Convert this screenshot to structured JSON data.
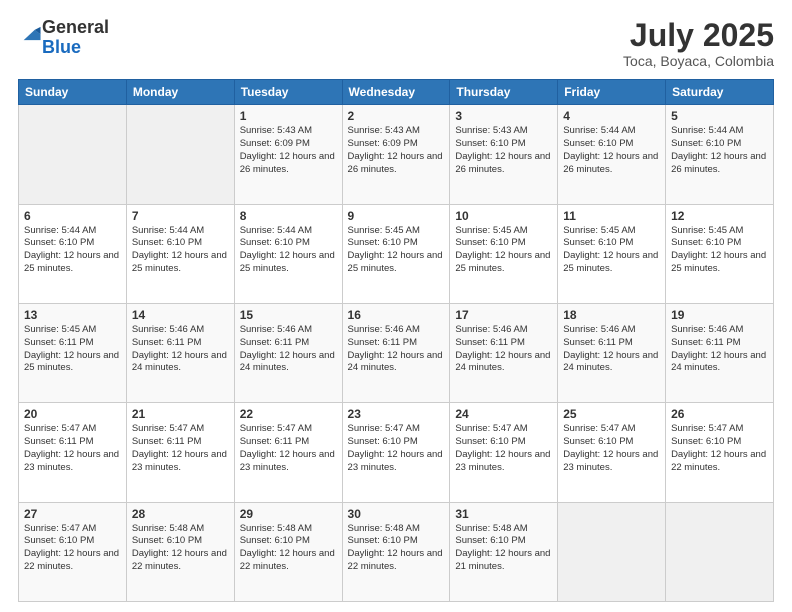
{
  "logo": {
    "general": "General",
    "blue": "Blue"
  },
  "title": {
    "month_year": "July 2025",
    "location": "Toca, Boyaca, Colombia"
  },
  "weekdays": [
    "Sunday",
    "Monday",
    "Tuesday",
    "Wednesday",
    "Thursday",
    "Friday",
    "Saturday"
  ],
  "weeks": [
    [
      {
        "day": "",
        "info": ""
      },
      {
        "day": "",
        "info": ""
      },
      {
        "day": "1",
        "info": "Sunrise: 5:43 AM\nSunset: 6:09 PM\nDaylight: 12 hours and 26 minutes."
      },
      {
        "day": "2",
        "info": "Sunrise: 5:43 AM\nSunset: 6:09 PM\nDaylight: 12 hours and 26 minutes."
      },
      {
        "day": "3",
        "info": "Sunrise: 5:43 AM\nSunset: 6:10 PM\nDaylight: 12 hours and 26 minutes."
      },
      {
        "day": "4",
        "info": "Sunrise: 5:44 AM\nSunset: 6:10 PM\nDaylight: 12 hours and 26 minutes."
      },
      {
        "day": "5",
        "info": "Sunrise: 5:44 AM\nSunset: 6:10 PM\nDaylight: 12 hours and 26 minutes."
      }
    ],
    [
      {
        "day": "6",
        "info": "Sunrise: 5:44 AM\nSunset: 6:10 PM\nDaylight: 12 hours and 25 minutes."
      },
      {
        "day": "7",
        "info": "Sunrise: 5:44 AM\nSunset: 6:10 PM\nDaylight: 12 hours and 25 minutes."
      },
      {
        "day": "8",
        "info": "Sunrise: 5:44 AM\nSunset: 6:10 PM\nDaylight: 12 hours and 25 minutes."
      },
      {
        "day": "9",
        "info": "Sunrise: 5:45 AM\nSunset: 6:10 PM\nDaylight: 12 hours and 25 minutes."
      },
      {
        "day": "10",
        "info": "Sunrise: 5:45 AM\nSunset: 6:10 PM\nDaylight: 12 hours and 25 minutes."
      },
      {
        "day": "11",
        "info": "Sunrise: 5:45 AM\nSunset: 6:10 PM\nDaylight: 12 hours and 25 minutes."
      },
      {
        "day": "12",
        "info": "Sunrise: 5:45 AM\nSunset: 6:10 PM\nDaylight: 12 hours and 25 minutes."
      }
    ],
    [
      {
        "day": "13",
        "info": "Sunrise: 5:45 AM\nSunset: 6:11 PM\nDaylight: 12 hours and 25 minutes."
      },
      {
        "day": "14",
        "info": "Sunrise: 5:46 AM\nSunset: 6:11 PM\nDaylight: 12 hours and 24 minutes."
      },
      {
        "day": "15",
        "info": "Sunrise: 5:46 AM\nSunset: 6:11 PM\nDaylight: 12 hours and 24 minutes."
      },
      {
        "day": "16",
        "info": "Sunrise: 5:46 AM\nSunset: 6:11 PM\nDaylight: 12 hours and 24 minutes."
      },
      {
        "day": "17",
        "info": "Sunrise: 5:46 AM\nSunset: 6:11 PM\nDaylight: 12 hours and 24 minutes."
      },
      {
        "day": "18",
        "info": "Sunrise: 5:46 AM\nSunset: 6:11 PM\nDaylight: 12 hours and 24 minutes."
      },
      {
        "day": "19",
        "info": "Sunrise: 5:46 AM\nSunset: 6:11 PM\nDaylight: 12 hours and 24 minutes."
      }
    ],
    [
      {
        "day": "20",
        "info": "Sunrise: 5:47 AM\nSunset: 6:11 PM\nDaylight: 12 hours and 23 minutes."
      },
      {
        "day": "21",
        "info": "Sunrise: 5:47 AM\nSunset: 6:11 PM\nDaylight: 12 hours and 23 minutes."
      },
      {
        "day": "22",
        "info": "Sunrise: 5:47 AM\nSunset: 6:11 PM\nDaylight: 12 hours and 23 minutes."
      },
      {
        "day": "23",
        "info": "Sunrise: 5:47 AM\nSunset: 6:10 PM\nDaylight: 12 hours and 23 minutes."
      },
      {
        "day": "24",
        "info": "Sunrise: 5:47 AM\nSunset: 6:10 PM\nDaylight: 12 hours and 23 minutes."
      },
      {
        "day": "25",
        "info": "Sunrise: 5:47 AM\nSunset: 6:10 PM\nDaylight: 12 hours and 23 minutes."
      },
      {
        "day": "26",
        "info": "Sunrise: 5:47 AM\nSunset: 6:10 PM\nDaylight: 12 hours and 22 minutes."
      }
    ],
    [
      {
        "day": "27",
        "info": "Sunrise: 5:47 AM\nSunset: 6:10 PM\nDaylight: 12 hours and 22 minutes."
      },
      {
        "day": "28",
        "info": "Sunrise: 5:48 AM\nSunset: 6:10 PM\nDaylight: 12 hours and 22 minutes."
      },
      {
        "day": "29",
        "info": "Sunrise: 5:48 AM\nSunset: 6:10 PM\nDaylight: 12 hours and 22 minutes."
      },
      {
        "day": "30",
        "info": "Sunrise: 5:48 AM\nSunset: 6:10 PM\nDaylight: 12 hours and 22 minutes."
      },
      {
        "day": "31",
        "info": "Sunrise: 5:48 AM\nSunset: 6:10 PM\nDaylight: 12 hours and 21 minutes."
      },
      {
        "day": "",
        "info": ""
      },
      {
        "day": "",
        "info": ""
      }
    ]
  ]
}
